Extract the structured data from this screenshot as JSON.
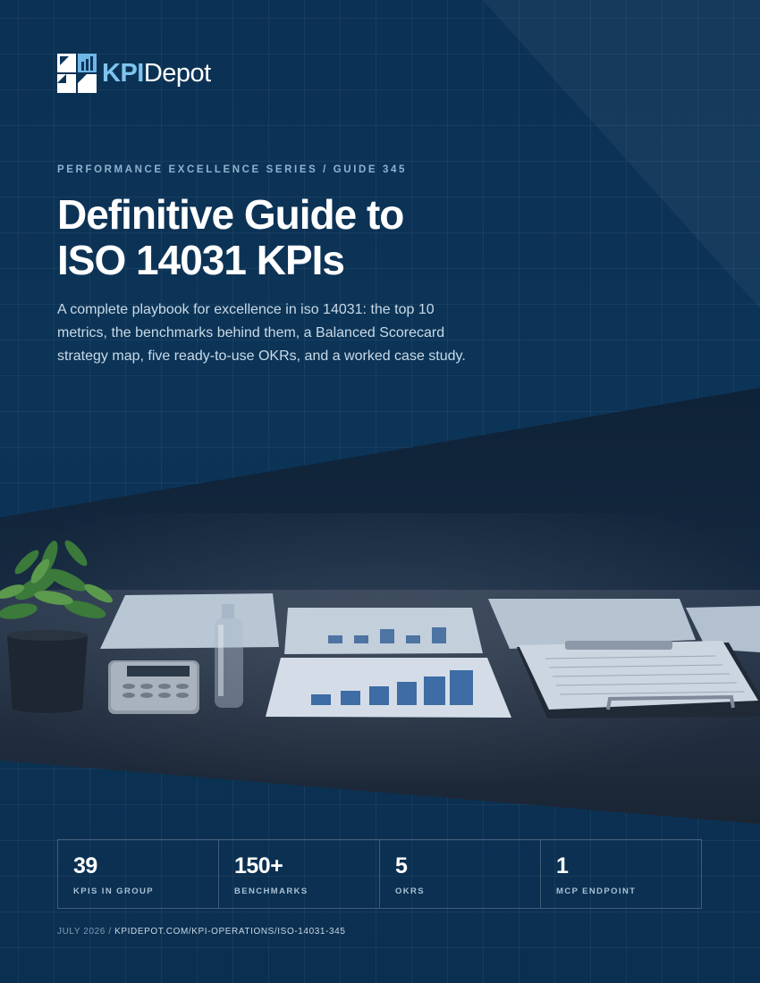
{
  "brand": {
    "name_strong": "KPI",
    "name_rest": "Depot"
  },
  "eyebrow": "PERFORMANCE EXCELLENCE SERIES / GUIDE 345",
  "title_line1": "Definitive Guide to",
  "title_line2": "ISO 14031 KPIs",
  "lede": "A complete playbook for excellence in iso 14031: the top 10 metrics, the benchmarks behind them, a Balanced Scorecard strategy map, five ready-to-use OKRs, and a worked case study.",
  "stats": [
    {
      "value": "39",
      "label": "KPIS IN GROUP"
    },
    {
      "value": "150+",
      "label": "BENCHMARKS"
    },
    {
      "value": "5",
      "label": "OKRS"
    },
    {
      "value": "1",
      "label": "MCP ENDPOINT"
    }
  ],
  "footer": {
    "date": "JULY 2026",
    "separator": " / ",
    "url": "KPIDEPOT.COM/KPI-OPERATIONS/ISO-14031-345"
  },
  "colors": {
    "background": "#0c3457",
    "accent": "#7fc4ee",
    "text": "#ffffff",
    "muted": "#8fb3cf"
  },
  "icons": {
    "logo": "kpidepot-logo-icon"
  }
}
